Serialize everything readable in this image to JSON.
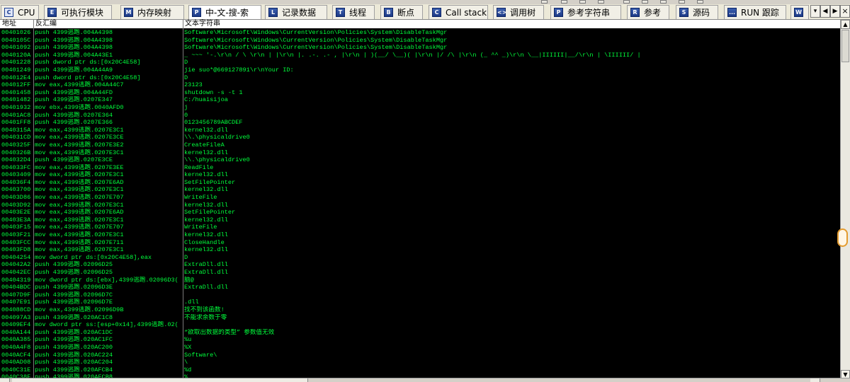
{
  "tabs": [
    {
      "label": "CPU",
      "icon": "C",
      "active": false
    },
    {
      "label": "可执行模块",
      "icon": "E",
      "active": false
    },
    {
      "label": "内存映射",
      "icon": "M",
      "active": false
    },
    {
      "label": "中-文-搜-索",
      "icon": "P",
      "active": true
    },
    {
      "label": "记录数据",
      "icon": "L",
      "active": false
    },
    {
      "label": "线程",
      "icon": "T",
      "active": false
    },
    {
      "label": "断点",
      "icon": "B",
      "active": false
    },
    {
      "label": "Call stack",
      "icon": "C",
      "active": false
    },
    {
      "label": "调用树",
      "icon": "<>",
      "active": false
    },
    {
      "label": "参考字符串",
      "icon": "P",
      "active": false
    },
    {
      "label": "参考",
      "icon": "R",
      "active": false
    },
    {
      "label": "源码",
      "icon": "S",
      "active": false
    },
    {
      "label": "RUN 跟踪",
      "icon": "...",
      "active": false
    },
    {
      "label": "W",
      "icon": "W",
      "active": false
    }
  ],
  "nav": {
    "prev": "◀",
    "next": "▶",
    "close": "×",
    "more": "▾"
  },
  "columns": {
    "address": "地址",
    "disasm": "反汇编",
    "text": "文本字符串"
  },
  "rows": [
    {
      "addr": "00401026",
      "dis": "push 4399逃跑.004A4398",
      "txt": "Software\\Microsoft\\Windows\\CurrentVersion\\Policies\\System\\DisableTaskMgr"
    },
    {
      "addr": "0040105C",
      "dis": "push 4399逃跑.004A4398",
      "txt": "Software\\Microsoft\\Windows\\CurrentVersion\\Policies\\System\\DisableTaskMgr"
    },
    {
      "addr": "00401092",
      "dis": "push 4399逃跑.004A4398",
      "txt": "Software\\Microsoft\\Windows\\CurrentVersion\\Policies\\System\\DisableTaskMgr"
    },
    {
      "addr": "0040120A",
      "dis": "push 4399逃跑.004A43E1",
      "txt": "  _  ~~~  '-.\\r\\n  /           \\ \\r\\n |         |\\r\\n |.  .-.  .-  , |\\r\\n | )(__/  \\__)( |\\r\\n |/    /\\     |\\r\\n (_    ^^    _)\\r\\n  \\__|IIIIII|__/\\r\\n   | \\IIIIII/ |"
    },
    {
      "addr": "00401228",
      "dis": "push dword ptr ds:[0x20C4E58]",
      "txt": "D"
    },
    {
      "addr": "00401249",
      "dis": "push 4399逃跑.004A44A9",
      "txt": "jie suo*@669127891\\r\\nYour ID:"
    },
    {
      "addr": "004012E4",
      "dis": "push dword ptr ds:[0x20C4E58]",
      "txt": "D"
    },
    {
      "addr": "004012FF",
      "dis": "mov eax,4399逃跑.004A44C7",
      "txt": "23123"
    },
    {
      "addr": "00401458",
      "dis": "push 4399逃跑.004A44FD",
      "txt": "shutdown -s -t 1"
    },
    {
      "addr": "00401482",
      "dis": "push 4399逃跑.0207E347",
      "txt": "C:/huaisijoa"
    },
    {
      "addr": "00401932",
      "dis": "mov ebx,4399逃跑.0040AFD0",
      "txt": "j"
    },
    {
      "addr": "00401AC8",
      "dis": "push 4399逃跑.0207E364",
      "txt": "0"
    },
    {
      "addr": "00401FF8",
      "dis": "push 4399逃跑.0207E366",
      "txt": "0123456789ABCDEF"
    },
    {
      "addr": "0040315A",
      "dis": "mov eax,4399逃跑.0207E3C1",
      "txt": "kernel32.dll"
    },
    {
      "addr": "004031CD",
      "dis": "mov eax,4399逃跑.0207E3CE",
      "txt": "\\\\.\\physicaldrive0"
    },
    {
      "addr": "0040325F",
      "dis": "mov eax,4399逃跑.0207E3E2",
      "txt": "CreateFileA"
    },
    {
      "addr": "0040326B",
      "dis": "mov eax,4399逃跑.0207E3C1",
      "txt": "kernel32.dll"
    },
    {
      "addr": "004032D4",
      "dis": "push 4399逃跑.0207E3CE",
      "txt": "\\\\.\\physicaldrive0"
    },
    {
      "addr": "004033FC",
      "dis": "mov eax,4399逃跑.0207E3EE",
      "txt": "ReadFile"
    },
    {
      "addr": "00403409",
      "dis": "mov eax,4399逃跑.0207E3C1",
      "txt": "kernel32.dll"
    },
    {
      "addr": "004036F4",
      "dis": "mov eax,4399逃跑.0207E6AD",
      "txt": "SetFilePointer"
    },
    {
      "addr": "00403700",
      "dis": "mov eax,4399逃跑.0207E3C1",
      "txt": "kernel32.dll"
    },
    {
      "addr": "00403D86",
      "dis": "mov eax,4399逃跑.0207E707",
      "txt": "WriteFile"
    },
    {
      "addr": "00403D92",
      "dis": "mov eax,4399逃跑.0207E3C1",
      "txt": "kernel32.dll"
    },
    {
      "addr": "00403E2E",
      "dis": "mov eax,4399逃跑.0207E6AD",
      "txt": "SetFilePointer"
    },
    {
      "addr": "00403E3A",
      "dis": "mov eax,4399逃跑.0207E3C1",
      "txt": "kernel32.dll"
    },
    {
      "addr": "00403F15",
      "dis": "mov eax,4399逃跑.0207E707",
      "txt": "WriteFile"
    },
    {
      "addr": "00403F21",
      "dis": "mov eax,4399逃跑.0207E3C1",
      "txt": "kernel32.dll"
    },
    {
      "addr": "00403FCC",
      "dis": "mov eax,4399逃跑.0207E711",
      "txt": "CloseHandle"
    },
    {
      "addr": "00403FD8",
      "dis": "mov eax,4399逃跑.0207E3C1",
      "txt": "kernel32.dll"
    },
    {
      "addr": "00404254",
      "dis": "mov dword ptr ds:[0x20C4E58],eax",
      "txt": "D"
    },
    {
      "addr": "004042A2",
      "dis": "push 4399逃跑.02096D25",
      "txt": "ExtraDll.dll"
    },
    {
      "addr": "004042EC",
      "dis": "push 4399逃跑.02096D25",
      "txt": "ExtraDll.dll"
    },
    {
      "addr": "00404319",
      "dis": "mov dword ptr ds:[ebx],4399逃跑.02096D3(",
      "txt": "脑@"
    },
    {
      "addr": "00404BDC",
      "dis": "push 4399逃跑.02096D3E",
      "txt": "ExtraDll.dll"
    },
    {
      "addr": "00407D9F",
      "dis": "push 4399逃跑.02096D7C",
      "txt": ""
    },
    {
      "addr": "00407E91",
      "dis": "push 4399逃跑.02096D7E",
      "txt": ".dll"
    },
    {
      "addr": "004088CD",
      "dis": "mov eax,4399逃跑.02096D9B",
      "txt": "找不到该函数!"
    },
    {
      "addr": "004097A3",
      "dis": "push 4399逃跑.020AC1C8",
      "txt": "不能求余数于零"
    },
    {
      "addr": "00409EF4",
      "dis": "mov dword ptr ss:[esp+0x14],4399逃跑.02(",
      "txt": ""
    },
    {
      "addr": "0040A144",
      "dis": "push 4399逃跑.020AC1DC",
      "txt": "“欲取出数据的类型” 参数值无效"
    },
    {
      "addr": "0040A385",
      "dis": "push 4399逃跑.020AC1FC",
      "txt": "%u"
    },
    {
      "addr": "0040A4F8",
      "dis": "push 4399逃跑.020AC200",
      "txt": "%X"
    },
    {
      "addr": "0040ACF4",
      "dis": "push 4399逃跑.020AC224",
      "txt": "Software\\"
    },
    {
      "addr": "0040AD08",
      "dis": "push 4399逃跑.020AC204",
      "txt": "\\"
    },
    {
      "addr": "0040C31E",
      "dis": "push 4399逃跑.020AFCB4",
      "txt": "%d"
    },
    {
      "addr": "0040C38F",
      "dis": "push 4399逃跑.020AFCB8",
      "txt": "%"
    }
  ],
  "colors": {
    "text": "#00ff3c",
    "background": "#000000",
    "tabbar": "#ece9d8",
    "scroll_handle": "#e39b2f"
  }
}
